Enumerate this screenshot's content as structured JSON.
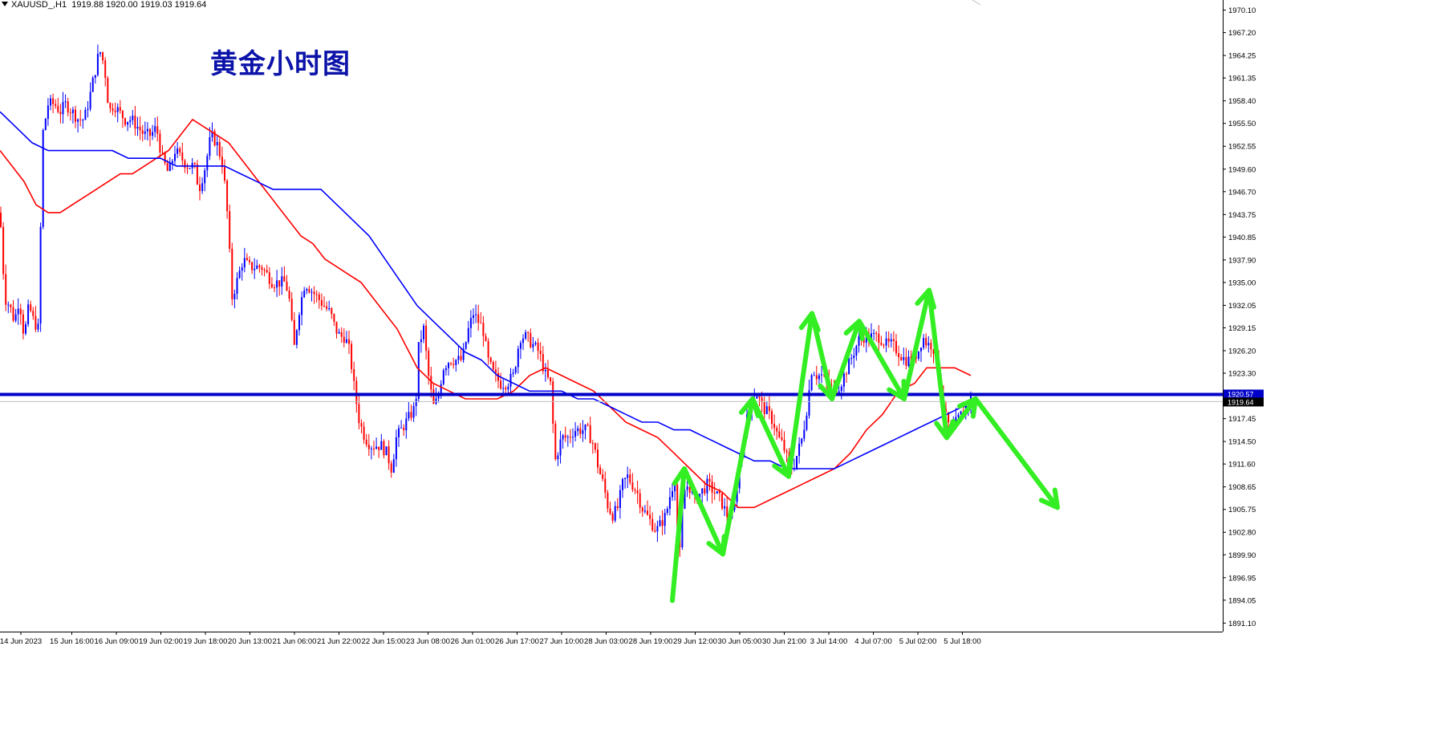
{
  "header": {
    "symbol": "XAUUSD_,H1",
    "ohlc": "1919.88 1920.00 1919.03 1919.64"
  },
  "chart_data": {
    "type": "candlestick",
    "title": "黄金小时图",
    "xlabel": "",
    "ylabel": "",
    "ylim": [
      1890.0,
      1971.4
    ],
    "y_ticks": [
      1970.1,
      1967.2,
      1964.25,
      1961.35,
      1958.4,
      1955.5,
      1952.55,
      1949.6,
      1946.7,
      1943.75,
      1940.85,
      1937.9,
      1935.0,
      1932.05,
      1929.15,
      1926.2,
      1923.3,
      1917.45,
      1914.5,
      1911.6,
      1908.65,
      1905.75,
      1902.8,
      1899.9,
      1896.95,
      1894.05,
      1891.1
    ],
    "x_ticks": [
      "14 Jun 2023",
      "15 Jun 16:00",
      "16 Jun 09:00",
      "19 Jun 02:00",
      "19 Jun 18:00",
      "20 Jun 13:00",
      "21 Jun 06:00",
      "21 Jun 22:00",
      "22 Jun 15:00",
      "23 Jun 08:00",
      "26 Jun 01:00",
      "26 Jun 17:00",
      "27 Jun 10:00",
      "28 Jun 03:00",
      "28 Jun 19:00",
      "29 Jun 12:00",
      "30 Jun 05:00",
      "30 Jun 21:00",
      "3 Jul 14:00",
      "4 Jul 07:00",
      "5 Jul 02:00",
      "5 Jul 18:00"
    ],
    "price_labels": {
      "support_line": "1920.57",
      "current_price": "1919.64"
    },
    "support_line": 1920.57,
    "current_price": 1919.64,
    "colors": {
      "bull": "#0000ff",
      "bear": "#ff0000",
      "ma_fast": "#ff0000",
      "ma_slow": "#0000ff",
      "support_line": "#0000c8",
      "annotation": "#33ee22",
      "title": "#0b12a8"
    },
    "close_path": [
      [
        0,
        1944
      ],
      [
        6,
        1933
      ],
      [
        12,
        1932
      ],
      [
        18,
        1930
      ],
      [
        24,
        1933
      ],
      [
        30,
        1928
      ],
      [
        36,
        1932
      ],
      [
        42,
        1930
      ],
      [
        48,
        1929
      ],
      [
        53,
        1954
      ],
      [
        60,
        1958
      ],
      [
        68,
        1958
      ],
      [
        75,
        1957
      ],
      [
        82,
        1958
      ],
      [
        90,
        1957
      ],
      [
        98,
        1956
      ],
      [
        105,
        1956
      ],
      [
        112,
        1959
      ],
      [
        118,
        1962
      ],
      [
        124,
        1965
      ],
      [
        130,
        1963
      ],
      [
        136,
        1957
      ],
      [
        142,
        1958
      ],
      [
        148,
        1957
      ],
      [
        156,
        1956
      ],
      [
        164,
        1956
      ],
      [
        172,
        1955
      ],
      [
        180,
        1954
      ],
      [
        188,
        1954
      ],
      [
        195,
        1955
      ],
      [
        202,
        1951
      ],
      [
        210,
        1949
      ],
      [
        218,
        1952
      ],
      [
        226,
        1951
      ],
      [
        234,
        1950
      ],
      [
        242,
        1950
      ],
      [
        248,
        1947
      ],
      [
        256,
        1950
      ],
      [
        263,
        1954
      ],
      [
        270,
        1953
      ],
      [
        278,
        1950
      ],
      [
        284,
        1943
      ],
      [
        289,
        1933
      ],
      [
        295,
        1935
      ],
      [
        303,
        1938
      ],
      [
        310,
        1937
      ],
      [
        318,
        1937
      ],
      [
        326,
        1937
      ],
      [
        333,
        1936
      ],
      [
        340,
        1935
      ],
      [
        348,
        1935
      ],
      [
        356,
        1935
      ],
      [
        362,
        1932
      ],
      [
        366,
        1926
      ],
      [
        372,
        1931
      ],
      [
        380,
        1935
      ],
      [
        388,
        1934
      ],
      [
        396,
        1933
      ],
      [
        404,
        1932
      ],
      [
        412,
        1931
      ],
      [
        418,
        1929
      ],
      [
        424,
        1928
      ],
      [
        430,
        1928
      ],
      [
        436,
        1926
      ],
      [
        442,
        1921
      ],
      [
        448,
        1917
      ],
      [
        455,
        1915
      ],
      [
        462,
        1914
      ],
      [
        468,
        1914
      ],
      [
        475,
        1914
      ],
      [
        482,
        1913
      ],
      [
        488,
        1911
      ],
      [
        494,
        1915
      ],
      [
        500,
        1916
      ],
      [
        506,
        1917
      ],
      [
        512,
        1918
      ],
      [
        518,
        1919
      ],
      [
        522,
        1927
      ],
      [
        528,
        1929
      ],
      [
        534,
        1923
      ],
      [
        540,
        1919
      ],
      [
        546,
        1920
      ],
      [
        552,
        1924
      ],
      [
        560,
        1925
      ],
      [
        568,
        1925
      ],
      [
        576,
        1925
      ],
      [
        584,
        1929
      ],
      [
        590,
        1931
      ],
      [
        596,
        1930
      ],
      [
        602,
        1929
      ],
      [
        608,
        1925
      ],
      [
        616,
        1923
      ],
      [
        624,
        1922
      ],
      [
        632,
        1922
      ],
      [
        640,
        1923
      ],
      [
        648,
        1928
      ],
      [
        656,
        1928
      ],
      [
        664,
        1927
      ],
      [
        672,
        1926
      ],
      [
        680,
        1923
      ],
      [
        686,
        1922
      ],
      [
        692,
        1912
      ],
      [
        700,
        1915
      ],
      [
        708,
        1915
      ],
      [
        716,
        1916
      ],
      [
        724,
        1916
      ],
      [
        732,
        1916
      ],
      [
        740,
        1914
      ],
      [
        746,
        1911
      ],
      [
        752,
        1909
      ],
      [
        758,
        1906
      ],
      [
        764,
        1905
      ],
      [
        770,
        1906
      ],
      [
        776,
        1909
      ],
      [
        782,
        1910
      ],
      [
        788,
        1909
      ],
      [
        794,
        1908
      ],
      [
        800,
        1906
      ],
      [
        806,
        1905
      ],
      [
        812,
        1904
      ],
      [
        818,
        1903
      ],
      [
        824,
        1904
      ],
      [
        830,
        1905
      ],
      [
        836,
        1908
      ],
      [
        842,
        1910
      ],
      [
        846,
        1898
      ],
      [
        852,
        1908
      ],
      [
        858,
        1909
      ],
      [
        866,
        1907
      ],
      [
        874,
        1908
      ],
      [
        882,
        1909
      ],
      [
        890,
        1908
      ],
      [
        898,
        1907
      ],
      [
        906,
        1905
      ],
      [
        914,
        1905
      ],
      [
        922,
        1912
      ],
      [
        930,
        1917
      ],
      [
        936,
        1919
      ],
      [
        942,
        1921
      ],
      [
        950,
        1919
      ],
      [
        958,
        1918
      ],
      [
        964,
        1917
      ],
      [
        970,
        1915
      ],
      [
        976,
        1914
      ],
      [
        982,
        1912
      ],
      [
        988,
        1911
      ],
      [
        994,
        1913
      ],
      [
        1000,
        1915
      ],
      [
        1006,
        1919
      ],
      [
        1012,
        1924
      ],
      [
        1018,
        1923
      ],
      [
        1024,
        1923
      ],
      [
        1032,
        1922
      ],
      [
        1040,
        1921
      ],
      [
        1048,
        1922
      ],
      [
        1056,
        1924
      ],
      [
        1064,
        1926
      ],
      [
        1072,
        1928
      ],
      [
        1080,
        1928
      ],
      [
        1088,
        1928
      ],
      [
        1096,
        1928
      ],
      [
        1104,
        1927
      ],
      [
        1112,
        1927
      ],
      [
        1120,
        1926
      ],
      [
        1128,
        1925
      ],
      [
        1136,
        1925
      ],
      [
        1144,
        1926
      ],
      [
        1150,
        1928
      ],
      [
        1156,
        1927
      ],
      [
        1162,
        1927
      ],
      [
        1168,
        1925
      ],
      [
        1174,
        1920
      ],
      [
        1180,
        1917
      ],
      [
        1186,
        1916
      ],
      [
        1192,
        1917
      ],
      [
        1198,
        1918
      ],
      [
        1204,
        1919
      ],
      [
        1210,
        1920
      ],
      [
        1214,
        1920
      ]
    ],
    "ma_fast_path": [
      [
        0,
        1952
      ],
      [
        15,
        1950
      ],
      [
        30,
        1948
      ],
      [
        45,
        1945
      ],
      [
        60,
        1944
      ],
      [
        75,
        1944
      ],
      [
        90,
        1945
      ],
      [
        105,
        1946
      ],
      [
        120,
        1947
      ],
      [
        135,
        1948
      ],
      [
        150,
        1949
      ],
      [
        165,
        1949
      ],
      [
        180,
        1950
      ],
      [
        195,
        1951
      ],
      [
        210,
        1952
      ],
      [
        225,
        1954
      ],
      [
        240,
        1956
      ],
      [
        255,
        1955
      ],
      [
        270,
        1954
      ],
      [
        285,
        1953
      ],
      [
        300,
        1951
      ],
      [
        315,
        1949
      ],
      [
        330,
        1947
      ],
      [
        345,
        1945
      ],
      [
        360,
        1943
      ],
      [
        375,
        1941
      ],
      [
        390,
        1940
      ],
      [
        405,
        1938
      ],
      [
        420,
        1937
      ],
      [
        435,
        1936
      ],
      [
        450,
        1935
      ],
      [
        465,
        1933
      ],
      [
        480,
        1931
      ],
      [
        495,
        1929
      ],
      [
        510,
        1926
      ],
      [
        520,
        1924
      ],
      [
        540,
        1922
      ],
      [
        560,
        1921
      ],
      [
        580,
        1920
      ],
      [
        600,
        1920
      ],
      [
        620,
        1920
      ],
      [
        640,
        1921
      ],
      [
        660,
        1923
      ],
      [
        680,
        1924
      ],
      [
        700,
        1923
      ],
      [
        720,
        1922
      ],
      [
        740,
        1921
      ],
      [
        760,
        1919
      ],
      [
        780,
        1917
      ],
      [
        800,
        1916
      ],
      [
        820,
        1915
      ],
      [
        840,
        1913
      ],
      [
        860,
        1911
      ],
      [
        880,
        1909
      ],
      [
        900,
        1908
      ],
      [
        920,
        1906
      ],
      [
        940,
        1906
      ],
      [
        960,
        1907
      ],
      [
        980,
        1908
      ],
      [
        1000,
        1909
      ],
      [
        1020,
        1910
      ],
      [
        1040,
        1911
      ],
      [
        1060,
        1913
      ],
      [
        1080,
        1916
      ],
      [
        1100,
        1918
      ],
      [
        1120,
        1921
      ],
      [
        1140,
        1922
      ],
      [
        1155,
        1924
      ],
      [
        1170,
        1924
      ],
      [
        1190,
        1924
      ],
      [
        1210,
        1923
      ]
    ],
    "ma_slow_path": [
      [
        0,
        1957
      ],
      [
        20,
        1955
      ],
      [
        40,
        1953
      ],
      [
        60,
        1952
      ],
      [
        80,
        1952
      ],
      [
        100,
        1952
      ],
      [
        120,
        1952
      ],
      [
        140,
        1952
      ],
      [
        160,
        1951
      ],
      [
        180,
        1951
      ],
      [
        200,
        1951
      ],
      [
        220,
        1950
      ],
      [
        240,
        1950
      ],
      [
        260,
        1950
      ],
      [
        280,
        1950
      ],
      [
        300,
        1949
      ],
      [
        320,
        1948
      ],
      [
        340,
        1947
      ],
      [
        360,
        1947
      ],
      [
        380,
        1947
      ],
      [
        400,
        1947
      ],
      [
        420,
        1945
      ],
      [
        440,
        1943
      ],
      [
        460,
        1941
      ],
      [
        480,
        1938
      ],
      [
        500,
        1935
      ],
      [
        520,
        1932
      ],
      [
        540,
        1930
      ],
      [
        560,
        1928
      ],
      [
        580,
        1926
      ],
      [
        600,
        1925
      ],
      [
        620,
        1923
      ],
      [
        640,
        1922
      ],
      [
        660,
        1921
      ],
      [
        680,
        1921
      ],
      [
        700,
        1921
      ],
      [
        720,
        1920
      ],
      [
        740,
        1920
      ],
      [
        760,
        1919
      ],
      [
        780,
        1918
      ],
      [
        800,
        1917
      ],
      [
        820,
        1917
      ],
      [
        840,
        1916
      ],
      [
        860,
        1916
      ],
      [
        880,
        1915
      ],
      [
        900,
        1914
      ],
      [
        920,
        1913
      ],
      [
        940,
        1912
      ],
      [
        960,
        1912
      ],
      [
        980,
        1911
      ],
      [
        1000,
        1911
      ],
      [
        1020,
        1911
      ],
      [
        1040,
        1911
      ],
      [
        1060,
        1912
      ],
      [
        1080,
        1913
      ],
      [
        1100,
        1914
      ],
      [
        1120,
        1915
      ],
      [
        1140,
        1916
      ],
      [
        1160,
        1917
      ],
      [
        1180,
        1918
      ],
      [
        1200,
        1919
      ],
      [
        1214,
        1919
      ]
    ],
    "annotation_zigzag": [
      [
        838,
        1894
      ],
      [
        853,
        1911
      ],
      [
        901,
        1900
      ],
      [
        938,
        1920
      ],
      [
        983,
        1910
      ],
      [
        1012,
        1931
      ],
      [
        1037,
        1920
      ],
      [
        1071,
        1930
      ],
      [
        1127,
        1920
      ],
      [
        1158,
        1934
      ],
      [
        1180,
        1915
      ],
      [
        1216,
        1920
      ],
      [
        1318,
        1906
      ]
    ]
  }
}
